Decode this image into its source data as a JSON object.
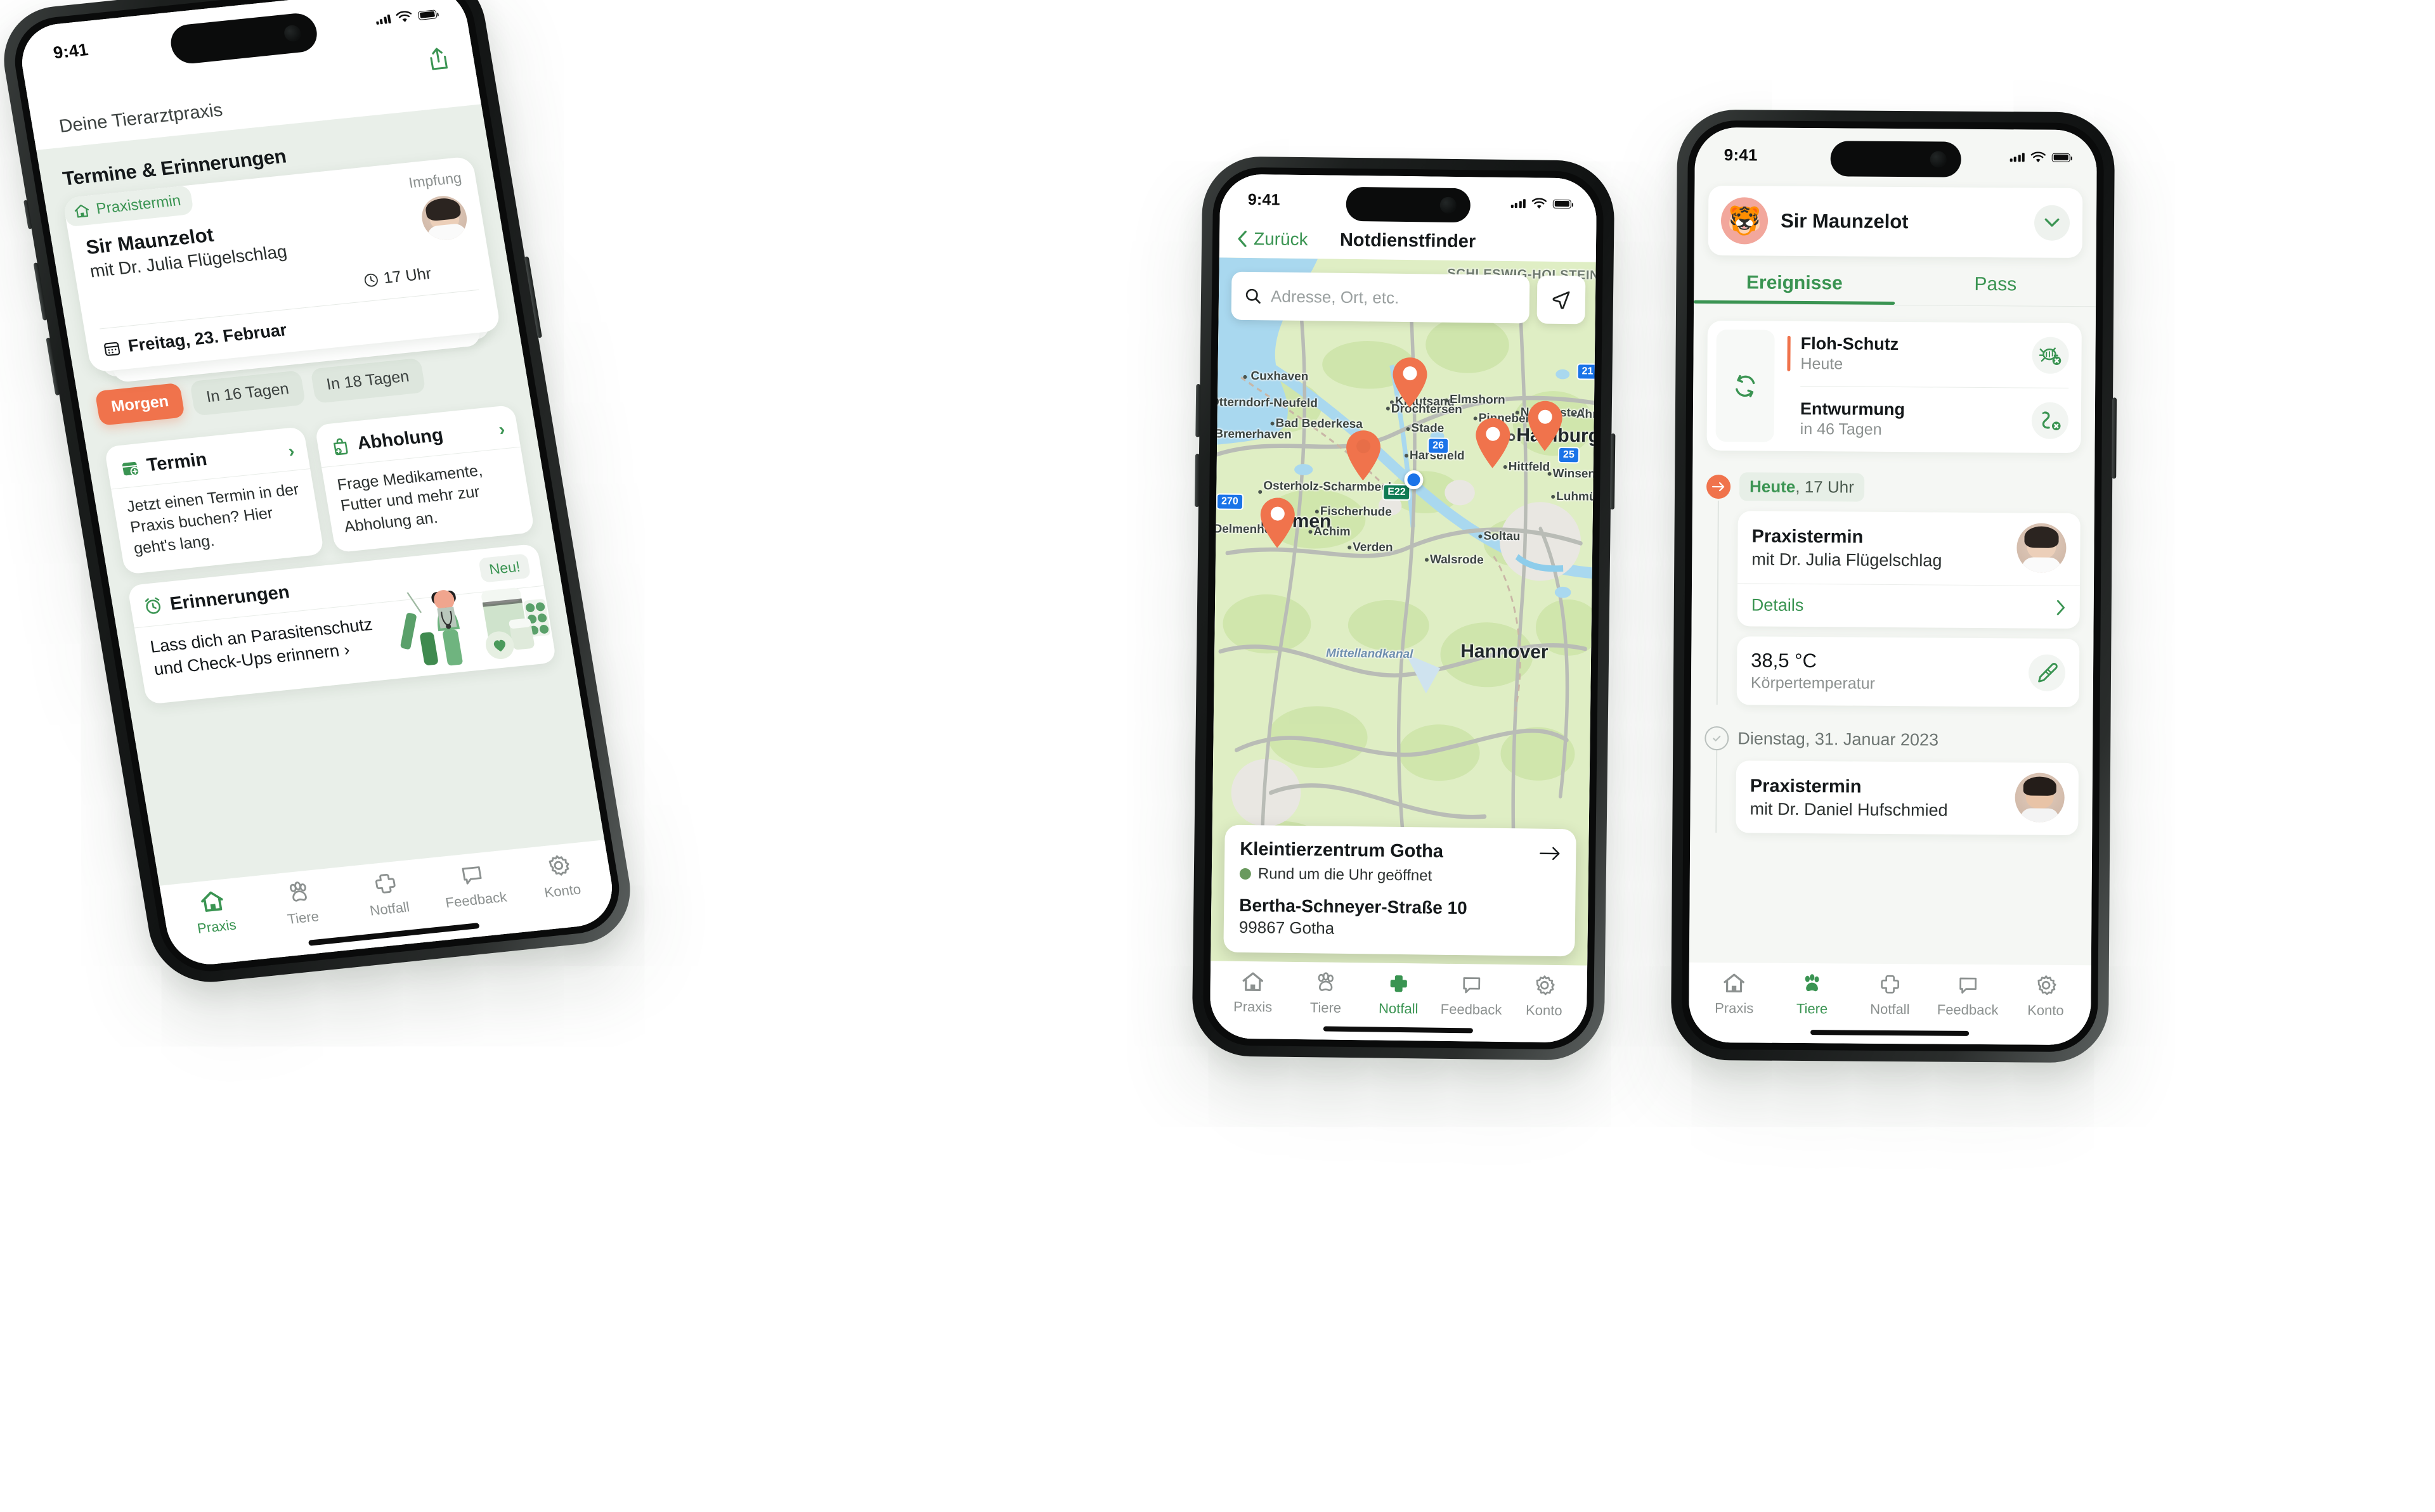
{
  "colors": {
    "brand_green": "#3a9452",
    "accent_orange": "#f0734c",
    "app_bg": "#e9efe9",
    "card_bg": "#ffffff",
    "muted_text": "#8c9190"
  },
  "phone1": {
    "status": {
      "time": "9:41",
      "signal": "cellular-bars-icon",
      "wifi": "wifi-icon",
      "battery": "battery-icon"
    },
    "share_icon": "share-icon",
    "practice_label": "Deine Tierarztpraxis",
    "section_title": "Termine & Erinnerungen",
    "appointment": {
      "chip": "Praxistermin",
      "chip_icon": "home-icon",
      "tag": "Impfung",
      "pet": "Sir Maunzelot",
      "doctor": "mit Dr. Julia Flügelschlag",
      "time": "17 Uhr",
      "time_icon": "clock-icon",
      "date": "Freitag, 23. Februar",
      "date_icon": "calendar-icon",
      "avatar": "doctor-avatar"
    },
    "pills": [
      {
        "label": "Morgen",
        "state": "active"
      },
      {
        "label": "In 16 Tagen",
        "state": "ghost"
      },
      {
        "label": "In 18 Tagen",
        "state": "ghost"
      }
    ],
    "cards": [
      {
        "title": "Termin",
        "icon": "calendar-plus-icon",
        "text": "Jetzt einen Termin in der Praxis buchen? Hier geht's lang.",
        "chevron": "chevron-right-icon"
      },
      {
        "title": "Abholung",
        "icon": "bag-plus-icon",
        "text": "Frage Medikamente, Futter und mehr zur Abholung an.",
        "chevron": "chevron-right-icon"
      }
    ],
    "reminder": {
      "title": "Erinnerungen",
      "icon": "alarm-clock-icon",
      "text": "Lass dich an Parasitenschutz und Check-Ups erinnern ›",
      "badge": "Neu!",
      "illustration": "vet-medicine-illustration"
    },
    "tabs": [
      {
        "label": "Praxis",
        "icon": "home-icon",
        "active": true
      },
      {
        "label": "Tiere",
        "icon": "paw-icon",
        "active": false
      },
      {
        "label": "Notfall",
        "icon": "cross-icon",
        "active": false
      },
      {
        "label": "Feedback",
        "icon": "chat-bubble-icon",
        "active": false
      },
      {
        "label": "Konto",
        "icon": "gear-icon",
        "active": false
      }
    ]
  },
  "phone2": {
    "status": {
      "time": "9:41"
    },
    "nav": {
      "back_label": "Zurück",
      "back_icon": "chevron-left-icon",
      "title": "Notdienstfinder"
    },
    "search": {
      "placeholder": "Adresse, Ort, etc.",
      "value": "",
      "icon": "search-icon"
    },
    "locate_icon": "navigate-arrow-icon",
    "map": {
      "region_labels": [
        "SCHLESWIG-HOLSTEIN"
      ],
      "city_labels": [
        "Cuxhaven",
        "Krautsand",
        "Elmshorn",
        "Drochtersen",
        "Pinneberg",
        "Norderstedt",
        "Ahrensburg",
        "Stade",
        "Hamburg",
        "Bad Bederkesa",
        "Bremerhaven",
        "Harsefeld",
        "Hittfeld",
        "Winsen",
        "Luhmühlen",
        "Osterholz-Scharmbeck",
        "Fischerhude",
        "Bremen",
        "Delmenhorst",
        "Achim",
        "Soltau",
        "Verden",
        "Walsrode",
        "Hannover",
        "Otterndorf-Neufeld",
        "Mittellandkanal"
      ],
      "road_shields": [
        "21",
        "26",
        "25",
        "270",
        "E22"
      ],
      "pin_count": 4,
      "user_location_icon": "blue-dot-icon"
    },
    "clinic": {
      "name": "Kleintierzentrum Gotha",
      "open_status": "Rund um die Uhr geöffnet",
      "street": "Bertha-Schneyer-Straße 10",
      "city": "99867 Gotha",
      "arrow_icon": "arrow-right-icon"
    },
    "tabs": [
      {
        "label": "Praxis",
        "icon": "home-icon",
        "active": false
      },
      {
        "label": "Tiere",
        "icon": "paw-icon",
        "active": false
      },
      {
        "label": "Notfall",
        "icon": "cross-icon",
        "active": true
      },
      {
        "label": "Feedback",
        "icon": "chat-bubble-icon",
        "active": false
      },
      {
        "label": "Konto",
        "icon": "gear-icon",
        "active": false
      }
    ]
  },
  "phone3": {
    "status": {
      "time": "9:41"
    },
    "pet": {
      "name": "Sir Maunzelot",
      "avatar_icon": "tiger-avatar-icon",
      "chevron": "chevron-down-icon"
    },
    "tabs": [
      {
        "label": "Ereignisse",
        "active": true
      },
      {
        "label": "Pass",
        "active": false
      }
    ],
    "protection": {
      "sync_icon": "refresh-icon",
      "rows": [
        {
          "title": "Floh-Schutz",
          "sub": "Heute",
          "icon": "flea-blocked-icon",
          "marker": "due"
        },
        {
          "title": "Entwurmung",
          "sub": "in 46 Tagen",
          "icon": "worm-blocked-icon",
          "marker": "none"
        }
      ]
    },
    "timeline": [
      {
        "bullet": "upcoming",
        "chip_bold": "Heute",
        "chip_rest": ", 17 Uhr",
        "event": {
          "title": "Praxistermin",
          "sub": "mit Dr. Julia Flügelschlag",
          "avatar": "doctor-avatar-julia",
          "details_label": "Details",
          "details_chevron": "chevron-right-icon"
        },
        "measure": {
          "value": "38,5 °C",
          "label": "Körpertemperatur",
          "icon": "thermometer-icon"
        }
      },
      {
        "bullet": "done",
        "date_label": "Dienstag, 31. Januar 2023",
        "event": {
          "title": "Praxistermin",
          "sub": "mit Dr. Daniel Hufschmied",
          "avatar": "doctor-avatar-daniel"
        }
      }
    ],
    "tabs_bottom": [
      {
        "label": "Praxis",
        "icon": "home-icon",
        "active": false
      },
      {
        "label": "Tiere",
        "icon": "paw-icon",
        "active": true
      },
      {
        "label": "Notfall",
        "icon": "cross-icon",
        "active": false
      },
      {
        "label": "Feedback",
        "icon": "chat-bubble-icon",
        "active": false
      },
      {
        "label": "Konto",
        "icon": "gear-icon",
        "active": false
      }
    ]
  }
}
